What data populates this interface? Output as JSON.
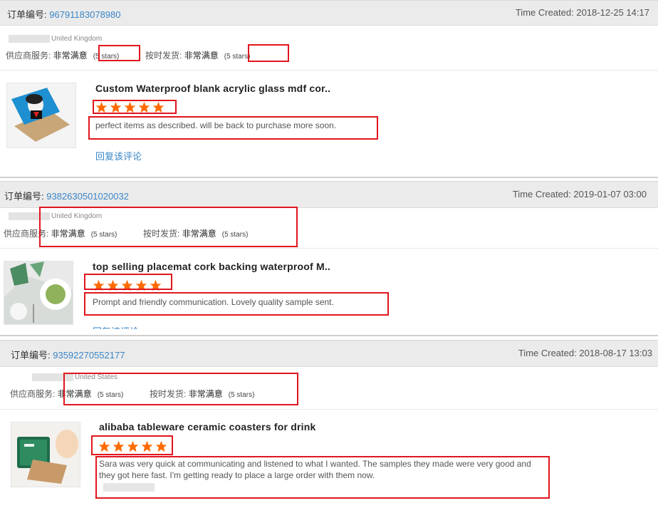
{
  "order_label": "订单编号: ",
  "time_label": "Time Created: ",
  "supplier_label": "供应商服务: ",
  "shipping_label": "按时发货: ",
  "very_satisfied": "非常满意",
  "reply_label": "回复该评论",
  "accent_color": "#3a86c8",
  "star_color": "#ff6a00",
  "highlight_color": "#e0161e",
  "orders": [
    {
      "order_number": "96791183078980",
      "time_created": "2018-12-25 14:17",
      "country": "United Kingdom",
      "supplier_stars": "(5 stars)",
      "shipping_stars": "(5 stars)",
      "product_title": "Custom Waterproof blank acrylic glass mdf cor..",
      "rating": 5,
      "review_text": "perfect items as described. will be back to purchase more soon."
    },
    {
      "order_number": "9382630501020032",
      "time_created": "2019-01-07 03:00",
      "country": "United Kingdom",
      "supplier_stars": "(5 stars)",
      "shipping_stars": "(5 stars)",
      "product_title": "top selling placemat cork backing waterproof M..",
      "rating": 5,
      "review_text": "Prompt and friendly communication. Lovely quality sample sent."
    },
    {
      "order_number": "93592270552177",
      "time_created": "2018-08-17 13:03",
      "country": "United States",
      "supplier_stars": "(5 stars)",
      "shipping_stars": "(5 stars)",
      "product_title": "alibaba tableware ceramic coasters for drink",
      "rating": 5,
      "review_text": "Sara was very quick at communicating and listened to what I wanted. The samples they made were very good and they got here fast. I'm getting ready to place a large order with them now."
    }
  ]
}
